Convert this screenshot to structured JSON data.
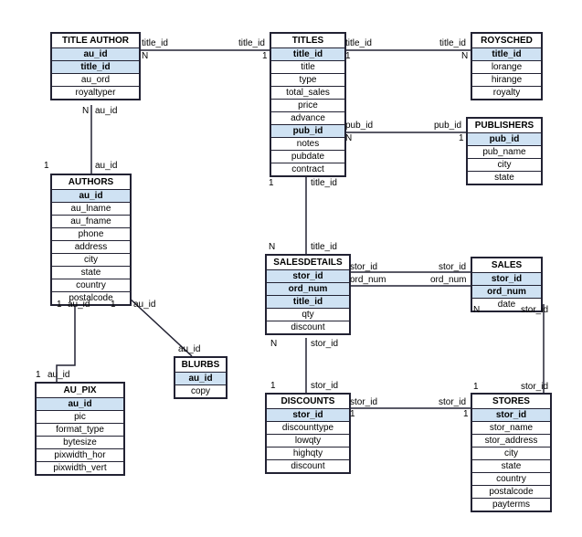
{
  "tables": {
    "title_author": {
      "name": "TITLE AUTHOR",
      "cols": [
        "au_id",
        "title_id",
        "au_ord",
        "royaltyper"
      ],
      "keys": [
        0,
        1
      ]
    },
    "authors": {
      "name": "AUTHORS",
      "cols": [
        "au_id",
        "au_lname",
        "au_fname",
        "phone",
        "address",
        "city",
        "state",
        "country",
        "postalcode"
      ],
      "keys": [
        0
      ]
    },
    "au_pix": {
      "name": "AU_PIX",
      "cols": [
        "au_id",
        "pic",
        "format_type",
        "bytesize",
        "pixwidth_hor",
        "pixwidth_vert"
      ],
      "keys": [
        0
      ]
    },
    "blurbs": {
      "name": "BLURBS",
      "cols": [
        "au_id",
        "copy"
      ],
      "keys": [
        0
      ]
    },
    "titles": {
      "name": "TITLES",
      "cols": [
        "title_id",
        "title",
        "type",
        "total_sales",
        "price",
        "advance",
        "pub_id",
        "notes",
        "pubdate",
        "contract"
      ],
      "keys": [
        0,
        6
      ]
    },
    "salesdetails": {
      "name": "SALESDETAILS",
      "cols": [
        "stor_id",
        "ord_num",
        "title_id",
        "qty",
        "discount"
      ],
      "keys": [
        0,
        1,
        2
      ]
    },
    "discounts": {
      "name": "DISCOUNTS",
      "cols": [
        "stor_id",
        "discounttype",
        "lowqty",
        "highqty",
        "discount"
      ],
      "keys": [
        0
      ]
    },
    "roysched": {
      "name": "ROYSCHED",
      "cols": [
        "title_id",
        "lorange",
        "hirange",
        "royalty"
      ],
      "keys": [
        0
      ]
    },
    "publishers": {
      "name": "PUBLISHERS",
      "cols": [
        "pub_id",
        "pub_name",
        "city",
        "state"
      ],
      "keys": [
        0
      ]
    },
    "sales": {
      "name": "SALES",
      "cols": [
        "stor_id",
        "ord_num",
        "date"
      ],
      "keys": [
        0,
        1
      ]
    },
    "stores": {
      "name": "STORES",
      "cols": [
        "stor_id",
        "stor_name",
        "stor_address",
        "city",
        "state",
        "country",
        "postalcode",
        "payterms"
      ],
      "keys": [
        0
      ]
    }
  },
  "relations": [
    {
      "label": "title_id",
      "ends": [
        "title_author.title_id N",
        "titles.title_id 1"
      ]
    },
    {
      "label": "au_id",
      "ends": [
        "title_author.au_id N",
        "authors.au_id 1"
      ]
    },
    {
      "label": "au_id",
      "ends": [
        "authors.au_id 1",
        "au_pix.au_id 1"
      ]
    },
    {
      "label": "au_id",
      "ends": [
        "authors.au_id 1",
        "blurbs.au_id 1"
      ]
    },
    {
      "label": "title_id",
      "ends": [
        "titles.title_id 1",
        "roysched.title_id N"
      ]
    },
    {
      "label": "pub_id",
      "ends": [
        "titles.pub_id N",
        "publishers.pub_id 1"
      ]
    },
    {
      "label": "title_id",
      "ends": [
        "titles.title_id 1",
        "salesdetails.title_id N"
      ]
    },
    {
      "label": "stor_id",
      "ends": [
        "salesdetails.stor_id N",
        "discounts.stor_id 1"
      ]
    },
    {
      "label": "stor_id/ord_num",
      "ends": [
        "salesdetails N",
        "sales 1"
      ]
    },
    {
      "label": "stor_id",
      "ends": [
        "sales.stor_id N",
        "stores.stor_id 1"
      ]
    },
    {
      "label": "stor_id",
      "ends": [
        "discounts.stor_id 1",
        "stores.stor_id 1"
      ]
    }
  ],
  "chart_data": {
    "type": "table",
    "description": "Entity-Relationship diagram (database schema) with 11 entities.",
    "entities": [
      "TITLE AUTHOR",
      "AUTHORS",
      "AU_PIX",
      "BLURBS",
      "TITLES",
      "SALESDETAILS",
      "DISCOUNTS",
      "ROYSCHED",
      "PUBLISHERS",
      "SALES",
      "STORES"
    ]
  }
}
